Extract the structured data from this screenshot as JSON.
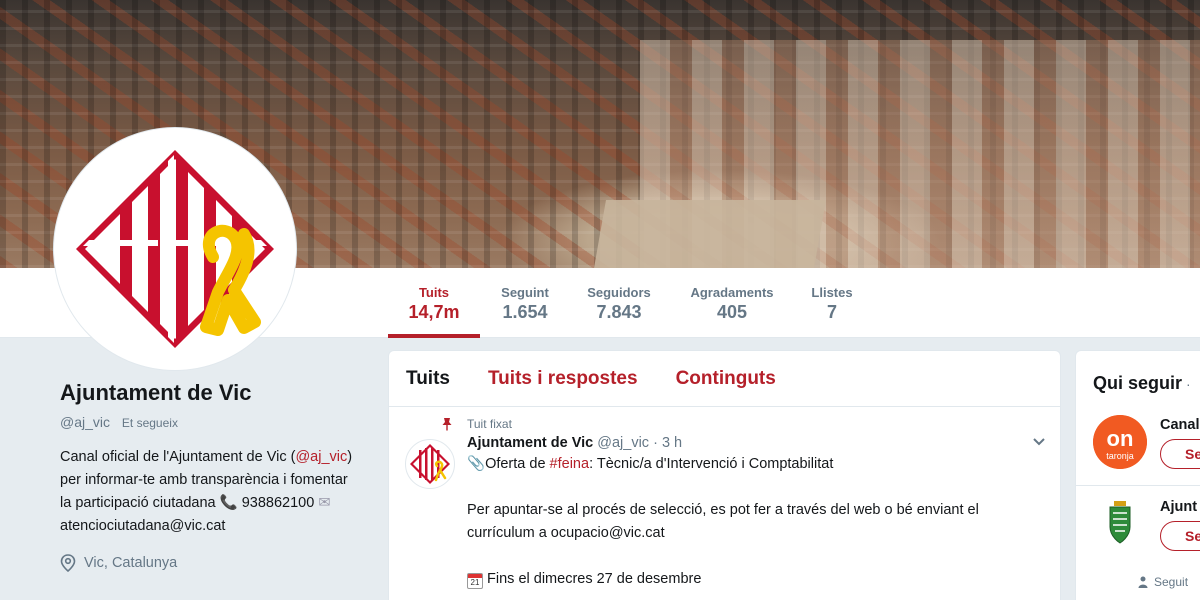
{
  "colors": {
    "accent": "#b5202a",
    "text": "#14171a",
    "muted": "#657786",
    "background": "#e6ecf0"
  },
  "nav": {
    "stats": [
      {
        "label": "Tuits",
        "value": "14,7m",
        "active": true
      },
      {
        "label": "Seguint",
        "value": "1.654"
      },
      {
        "label": "Seguidors",
        "value": "7.843"
      },
      {
        "label": "Agradaments",
        "value": "405"
      },
      {
        "label": "Llistes",
        "value": "7"
      }
    ]
  },
  "profile": {
    "name": "Ajuntament de Vic",
    "handle": "@aj_vic",
    "follows_you": "Et segueix",
    "bio_1": "Canal oficial de l'Ajuntament de Vic",
    "bio_handle": "@aj_vic",
    "bio_2": "per informar-te amb transparència i fomentar la participació ciutadana",
    "phone": "938862100",
    "email": "atenciociutadana@vic.cat",
    "location": "Vic, Catalunya"
  },
  "timeline": {
    "tabs": [
      "Tuits",
      "Tuits i respostes",
      "Continguts"
    ],
    "pinned_label": "Tuit fixat",
    "tweet": {
      "author": "Ajuntament de Vic",
      "handle": "@aj_vic",
      "time": "· 3 h",
      "line1_pre": "Oferta de ",
      "hashtag": "#feina",
      "line1_post": ": Tècnic/a d'Intervenció i Comptabilitat",
      "para2": "Per apuntar-se al procés de selecció, es pot fer a través del web o bé enviant el currículum a ocupacio@vic.cat",
      "para3": "Fins el dimecres 27 de desembre",
      "calendar_day": "21"
    }
  },
  "who_to_follow": {
    "title": "Qui seguir",
    "title_sep": "·",
    "accounts": [
      {
        "name": "Canal",
        "button": "Se",
        "avatar_text": "on",
        "avatar_sub": "taronja"
      },
      {
        "name": "Ajunt",
        "button": "Se"
      }
    ],
    "footer": "Seguit"
  },
  "icons": [
    "pin-icon",
    "paperclip-icon",
    "calendar-icon",
    "phone-icon",
    "envelope-icon",
    "location-pin-icon",
    "chevron-down-icon",
    "person-icon"
  ]
}
